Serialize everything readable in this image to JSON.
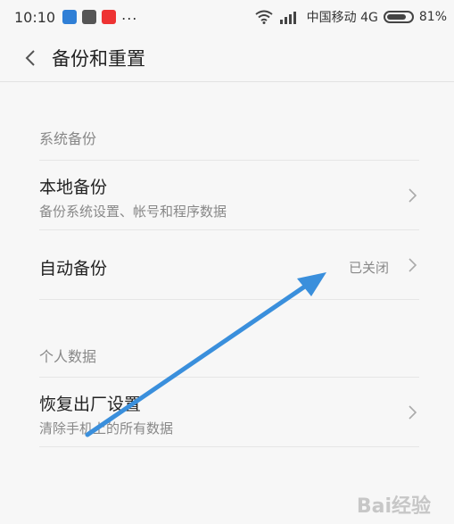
{
  "status_bar": {
    "time": "10:10",
    "more": "...",
    "carrier": "中国移动 4G",
    "battery_percent": "81%",
    "battery_level": 0.81
  },
  "header": {
    "title": "备份和重置"
  },
  "sections": [
    {
      "title": "系统备份",
      "items": [
        {
          "label": "本地备份",
          "subtitle": "备份系统设置、帐号和程序数据",
          "value": ""
        },
        {
          "label": "自动备份",
          "subtitle": "",
          "value": "已关闭"
        }
      ]
    },
    {
      "title": "个人数据",
      "items": [
        {
          "label": "恢复出厂设置",
          "subtitle": "清除手机上的所有数据",
          "value": ""
        }
      ]
    }
  ],
  "overlay": {
    "arrow_color": "#3a8fdc"
  },
  "watermark": {
    "text": "Bai经验"
  },
  "icons": {
    "back": "chevron-left-icon",
    "row_more": "chevron-right-icon",
    "wifi": "wifi-icon",
    "signal": "signal-icon",
    "battery": "battery-icon"
  }
}
